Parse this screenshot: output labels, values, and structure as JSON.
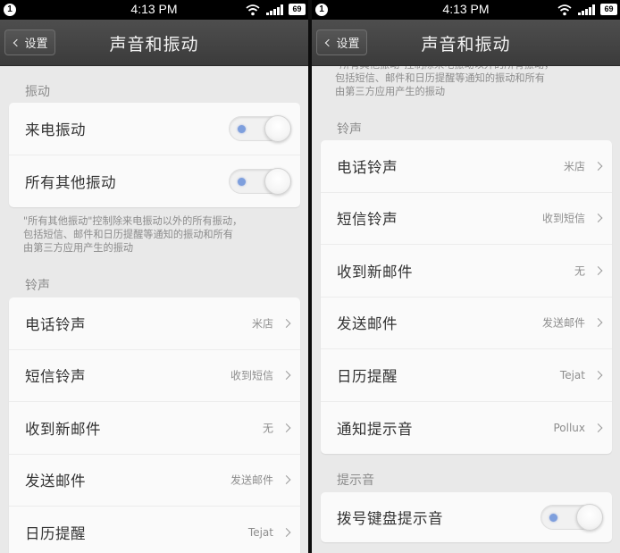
{
  "status_bar": {
    "notification_badge": "1",
    "time": "4:13 PM",
    "battery": "69"
  },
  "header": {
    "back_label": "设置",
    "title": "声音和振动"
  },
  "vibration": {
    "section_title": "振动",
    "incoming_call_vibrate": {
      "label": "来电振动",
      "enabled": false
    },
    "all_other_vibrate": {
      "label": "所有其他振动",
      "enabled": false
    },
    "description": "\"所有其他振动\"控制除来电振动以外的所有振动，\n包括短信、邮件和日历提醒等通知的振动和所有\n由第三方应用产生的振动"
  },
  "ringtones": {
    "section_title": "铃声",
    "items": [
      {
        "label": "电话铃声",
        "value": "米店"
      },
      {
        "label": "短信铃声",
        "value": "收到短信"
      },
      {
        "label": "收到新邮件",
        "value": "无"
      },
      {
        "label": "发送邮件",
        "value": "发送邮件"
      },
      {
        "label": "日历提醒",
        "value": "Tejat"
      },
      {
        "label": "通知提示音",
        "value": "Pollux"
      }
    ]
  },
  "prompt_tones": {
    "section_title": "提示音",
    "dialpad_tone": {
      "label": "拨号键盘提示音",
      "enabled": false
    }
  },
  "icons": [
    "back-chevron-icon",
    "chevron-right-icon",
    "wifi-icon",
    "signal-icon",
    "battery-icon"
  ],
  "colors": {
    "title_bar": "#444444",
    "background": "#e9e9e9",
    "card": "#fafafa",
    "toggle_dot": "#7e9fdd"
  }
}
